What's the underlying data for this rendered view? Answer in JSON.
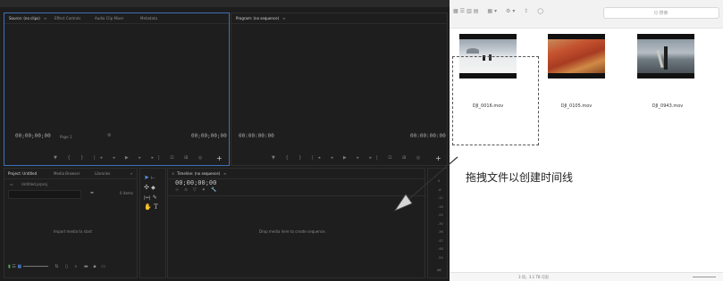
{
  "premiere": {
    "source_panel": {
      "tabs": [
        "Source: (no clips)",
        "Effect Controls",
        "Audio Clip Mixer",
        "Metadata"
      ],
      "tab_menu_glyph": "≡",
      "timecode_left": "00;00;00;00",
      "fit": "Page 1",
      "timecode_right": "00;00;00;00"
    },
    "program_panel": {
      "tab": "Program: (no sequence)",
      "tab_menu_glyph": "≡",
      "timecode_left": "00:00:00:00",
      "timecode_right": "00:00:00:00"
    },
    "project_panel": {
      "tabs": [
        "Project: Untitled",
        "Media Browser",
        "Libraries"
      ],
      "more": "»",
      "file": "Untitled.prproj",
      "items_count": "0 items",
      "empty_message": "Import media to start"
    },
    "timeline_panel": {
      "tab": "Timeline: (no sequence)",
      "timecode": "00;00;00;00",
      "empty_message": "Drop media here to create sequence."
    },
    "audio_meter": {
      "ticks": [
        "0",
        "-6",
        "-12",
        "-18",
        "-24",
        "-30",
        "-36",
        "-42",
        "-48",
        "-54"
      ],
      "label": "dB"
    }
  },
  "finder": {
    "search_placeholder": "Q 搜索",
    "files": [
      {
        "name": "DJI_0016.mov"
      },
      {
        "name": "DJI_0105.mov"
      },
      {
        "name": "DJI_0943.mov"
      }
    ],
    "status": "3 项，3.1 TB 可用"
  },
  "annotation": {
    "text": "拖拽文件以创建时间线"
  },
  "colors": {
    "panel_bg": "#1e1e1e",
    "active_border": "#3f6fb8",
    "accent_blue": "#5b9bff",
    "finder_bg": "#ffffff"
  }
}
